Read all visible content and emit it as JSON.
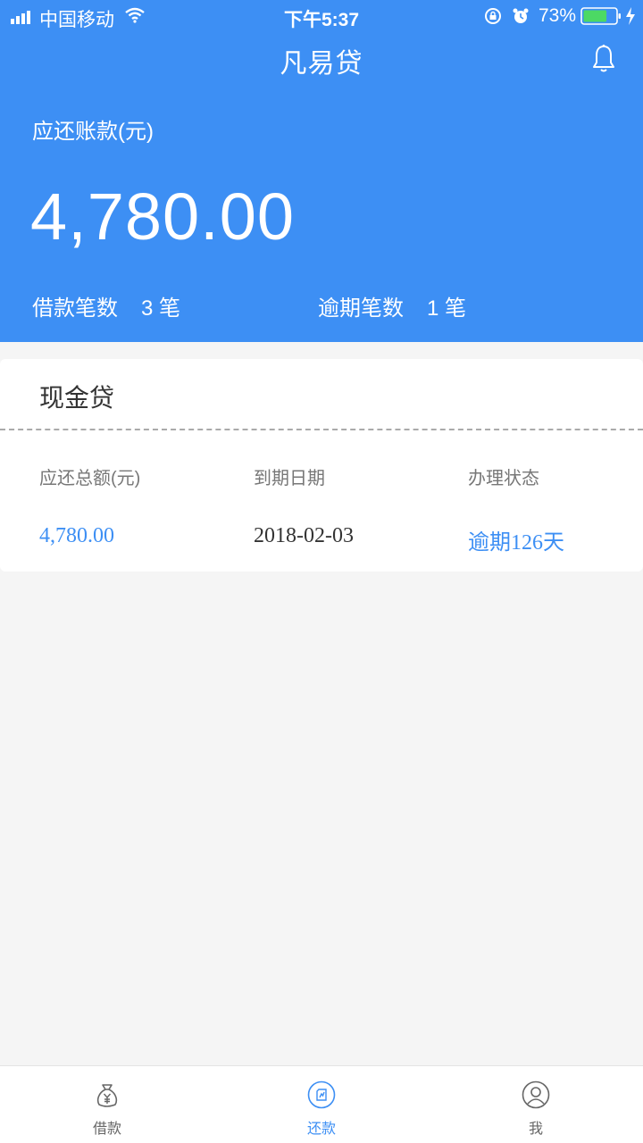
{
  "status_bar": {
    "carrier": "中国移动",
    "time": "下午5:37",
    "battery_percent": "73%",
    "battery_level": 0.73
  },
  "app": {
    "title": "凡易贷"
  },
  "summary": {
    "due_label": "应还账款(元)",
    "due_amount": "4,780.00",
    "loan_count_label": "借款笔数",
    "loan_count_value": "3 笔",
    "overdue_count_label": "逾期笔数",
    "overdue_count_value": "1 笔"
  },
  "loan_card": {
    "title": "现金贷",
    "headers": [
      "应还总额(元)",
      "到期日期",
      "办理状态"
    ],
    "values": [
      "4,780.00",
      "2018-02-03",
      "逾期126天"
    ]
  },
  "tabbar": {
    "items": [
      {
        "label": "借款",
        "icon": "money-bag-icon",
        "active": false
      },
      {
        "label": "还款",
        "icon": "repay-icon",
        "active": true
      },
      {
        "label": "我",
        "icon": "user-icon",
        "active": false
      }
    ]
  },
  "colors": {
    "primary": "#3d8ff4",
    "background": "#f5f5f5",
    "text_dark": "#333333",
    "text_muted": "#777777"
  }
}
